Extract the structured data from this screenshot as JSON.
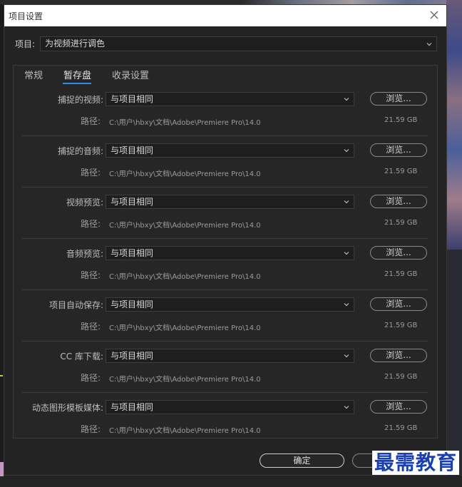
{
  "dialog": {
    "title": "项目设置",
    "project_label": "项目:",
    "project_name": "为视频进行调色"
  },
  "tabs": [
    {
      "label": "常规"
    },
    {
      "label": "暂存盘"
    },
    {
      "label": "收录设置"
    }
  ],
  "rows": [
    {
      "label": "捕捉的视频:",
      "value": "与项目相同",
      "browse": "浏览...",
      "path_label": "路径:",
      "path": "C:\\用户\\hbxy\\文档\\Adobe\\Premiere Pro\\14.0",
      "size": "21.59 GB"
    },
    {
      "label": "捕捉的音频:",
      "value": "与项目相同",
      "browse": "浏览...",
      "path_label": "路径:",
      "path": "C:\\用户\\hbxy\\文档\\Adobe\\Premiere Pro\\14.0",
      "size": "21.59 GB"
    },
    {
      "label": "视频预览:",
      "value": "与项目相同",
      "browse": "浏览...",
      "path_label": "路径:",
      "path": "C:\\用户\\hbxy\\文档\\Adobe\\Premiere Pro\\14.0",
      "size": "21.59 GB"
    },
    {
      "label": "音频预览:",
      "value": "与项目相同",
      "browse": "浏览...",
      "path_label": "路径:",
      "path": "C:\\用户\\hbxy\\文档\\Adobe\\Premiere Pro\\14.0",
      "size": "21.59 GB"
    },
    {
      "label": "项目自动保存:",
      "value": "与项目相同",
      "browse": "浏览...",
      "path_label": "路径:",
      "path": "C:\\用户\\hbxy\\文档\\Adobe\\Premiere Pro\\14.0",
      "size": "21.59 GB"
    },
    {
      "label": "CC 库下载:",
      "value": "与项目相同",
      "browse": "浏览...",
      "path_label": "路径:",
      "path": "C:\\用户\\hbxy\\文档\\Adobe\\Premiere Pro\\14.0",
      "size": "21.59 GB"
    },
    {
      "label": "动态图形模板媒体:",
      "value": "与项目相同",
      "browse": "浏览...",
      "path_label": "路径:",
      "path": "C:\\用户\\hbxy\\文档\\Adobe\\Premiere Pro\\14.0",
      "size": "21.59 GB"
    }
  ],
  "buttons": {
    "ok": "确定",
    "cancel": ""
  },
  "watermark": "最需教育",
  "icons": {
    "close": "close-icon",
    "caret": "chevron-down-icon"
  },
  "colors": {
    "accent": "#2d8ceb",
    "watermark": "#1a3fb0"
  }
}
